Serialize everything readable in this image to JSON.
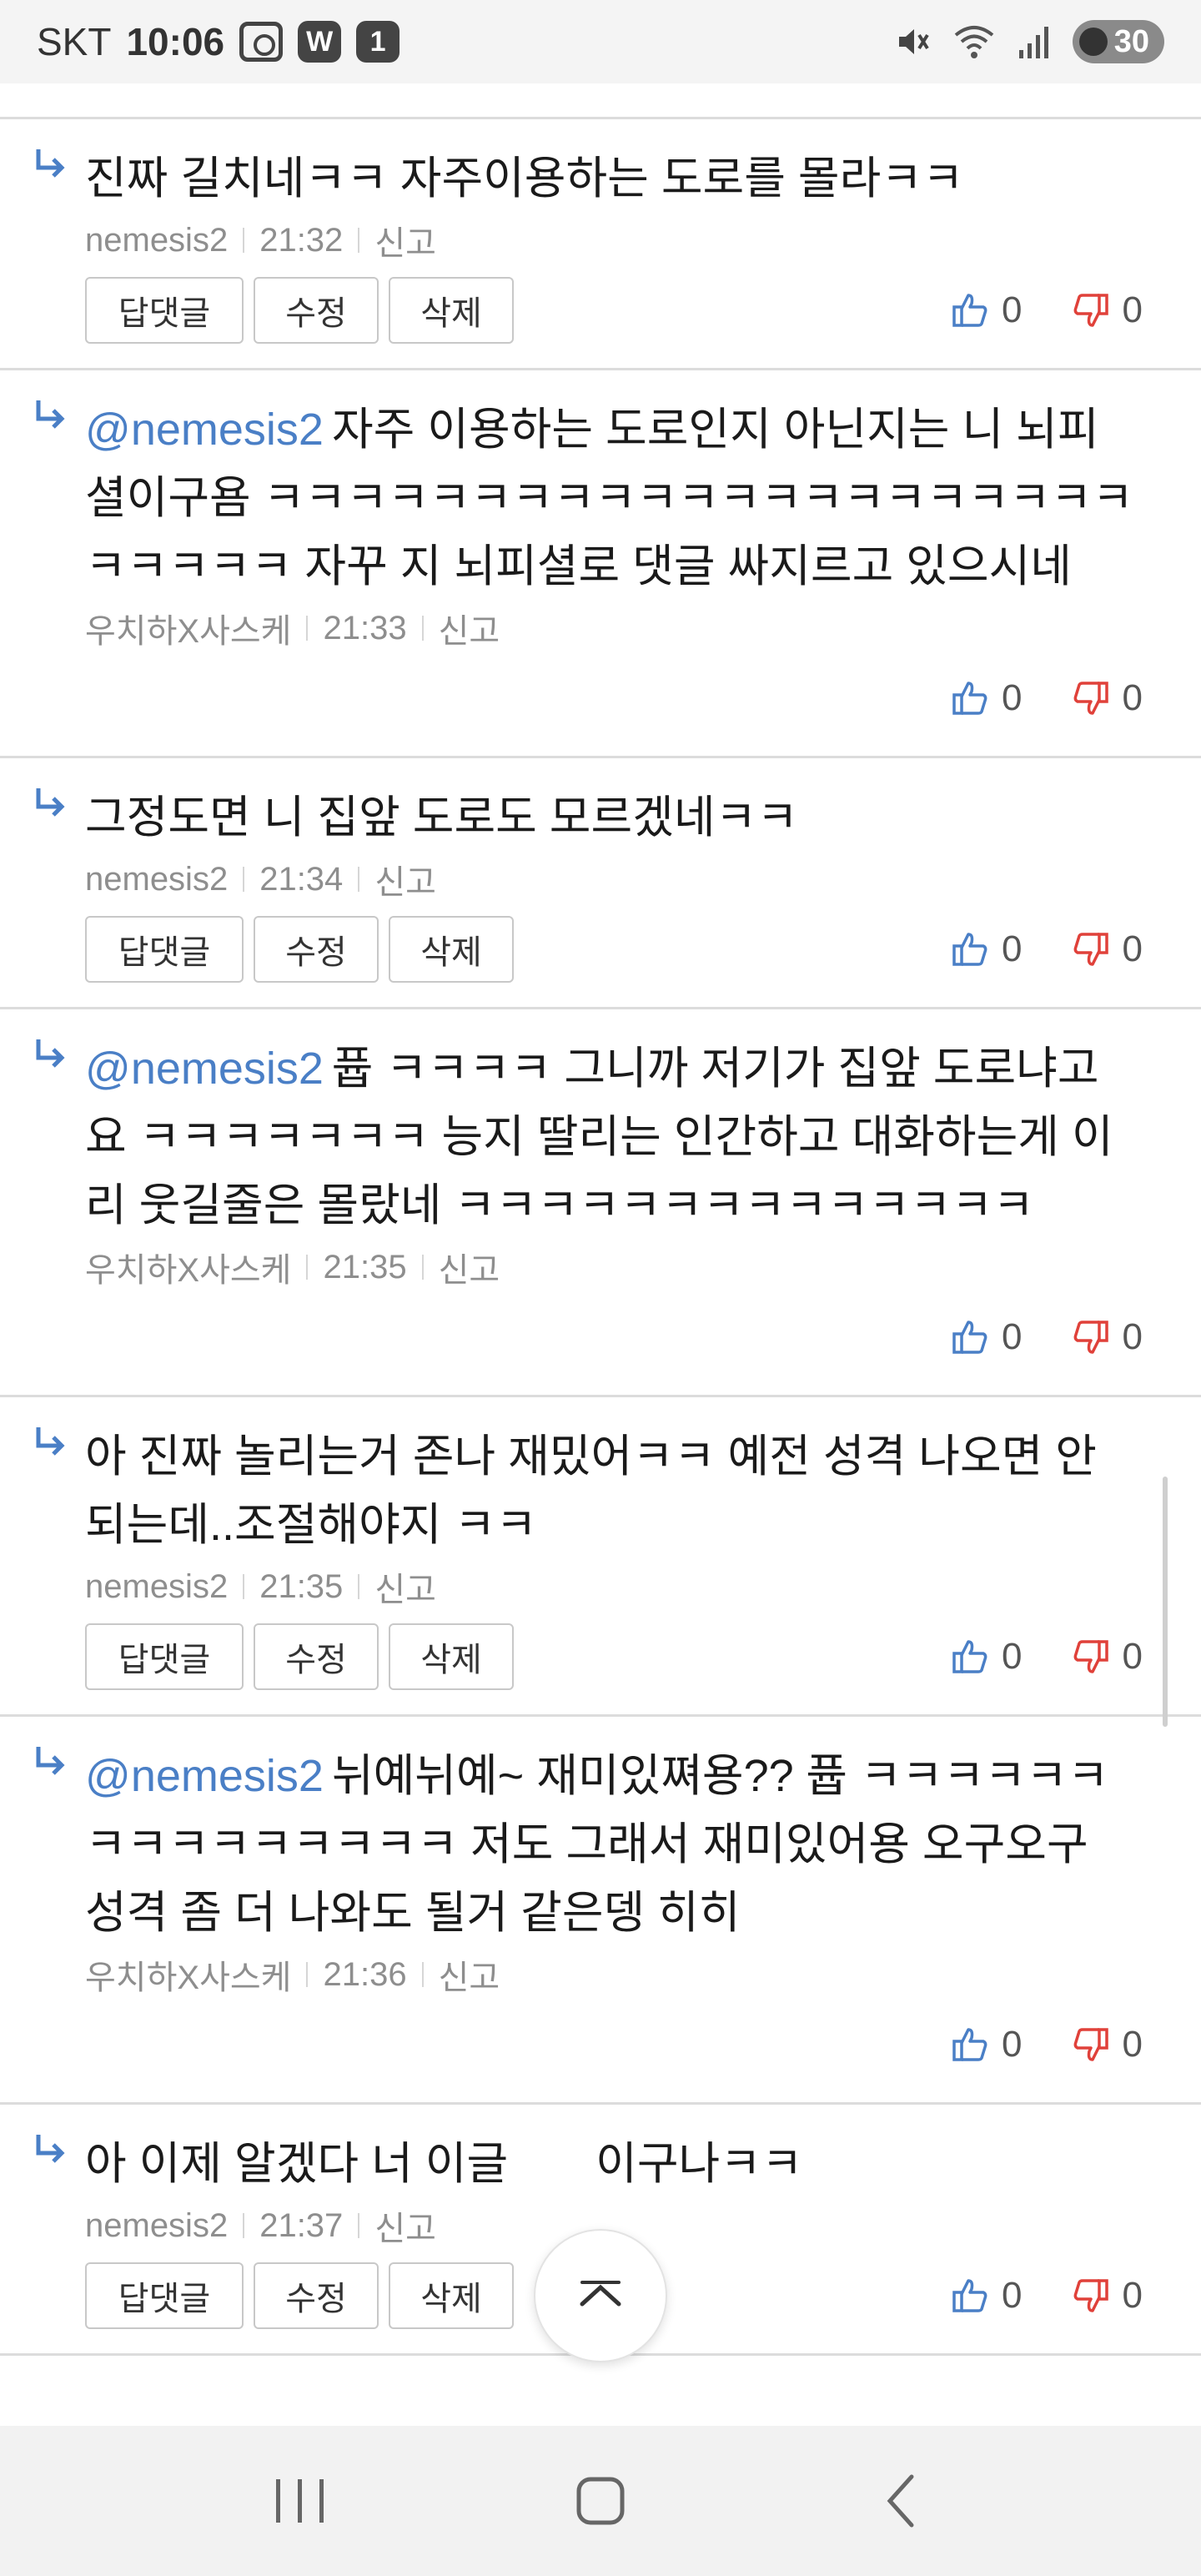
{
  "status_bar": {
    "carrier": "SKT",
    "time": "10:06",
    "badge_w": "W",
    "badge_count": "1",
    "battery": "30",
    "icons": [
      "screenshot-icon",
      "mute-icon",
      "wifi-icon",
      "signal-icon",
      "battery-icon"
    ]
  },
  "buttons": {
    "reply": "답댓글",
    "edit": "수정",
    "delete": "삭제"
  },
  "comments": [
    {
      "mention": "",
      "text": "진짜 길치네ㅋㅋ 자주이용하는 도로를 몰라ㅋㅋ",
      "author": "nemesis2",
      "time": "21:32",
      "report": "신고",
      "owned": true,
      "likes": "0",
      "dislikes": "0"
    },
    {
      "mention": "@nemesis2",
      "text": "자주 이용하는 도로인지 아닌지는 니 뇌피셜이구욤 ㅋㅋㅋㅋㅋㅋㅋㅋㅋㅋㅋㅋㅋㅋㅋㅋㅋㅋㅋㅋㅋㅋㅋㅋㅋㅋ 자꾸 지 뇌피셜로 댓글 싸지르고 있으시네",
      "author": "우치하X사스케",
      "time": "21:33",
      "report": "신고",
      "owned": false,
      "likes": "0",
      "dislikes": "0"
    },
    {
      "mention": "",
      "text": "그정도면 니 집앞 도로도 모르겠네ㅋㅋ",
      "author": "nemesis2",
      "time": "21:34",
      "report": "신고",
      "owned": true,
      "likes": "0",
      "dislikes": "0"
    },
    {
      "mention": "@nemesis2",
      "text": "퓹 ㅋㅋㅋㅋ 그니까 저기가 집앞 도로냐고요 ㅋㅋㅋㅋㅋㅋㅋ 능지 딸리는 인간하고 대화하는게 이리 웃길줄은 몰랐네 ㅋㅋㅋㅋㅋㅋㅋㅋㅋㅋㅋㅋㅋㅋ",
      "author": "우치하X사스케",
      "time": "21:35",
      "report": "신고",
      "owned": false,
      "likes": "0",
      "dislikes": "0"
    },
    {
      "mention": "",
      "text": "아 진짜 놀리는거 존나 재밌어ㅋㅋ 예전 성격 나오면 안되는데..조절해야지 ㅋㅋ",
      "author": "nemesis2",
      "time": "21:35",
      "report": "신고",
      "owned": true,
      "likes": "0",
      "dislikes": "0"
    },
    {
      "mention": "@nemesis2",
      "text": "뉘예뉘예~ 재미있쪄용?? 퓹 ㅋㅋㅋㅋㅋㅋㅋㅋㅋㅋㅋㅋㅋㅋㅋ 저도 그래서 재미있어용 오구오구 성격 좀 더 나와도 될거 같은뎅 히히",
      "author": "우치하X사스케",
      "time": "21:36",
      "report": "신고",
      "owned": false,
      "likes": "0",
      "dislikes": "0"
    },
    {
      "mention": "",
      "text": "아 이제 알겠다 너 이글 ",
      "text_after": "이구나ㅋㅋ",
      "author": "nemesis2",
      "time": "21:37",
      "report": "신고",
      "owned": true,
      "likes": "0",
      "dislikes": "0"
    }
  ],
  "colors": {
    "mention": "#4a7fc6",
    "like": "#4a7fc6",
    "dislike": "#e0413a",
    "meta": "#8e8e8e"
  },
  "nav_bar": {
    "icons": [
      "recent-apps-icon",
      "home-icon",
      "back-icon"
    ]
  }
}
